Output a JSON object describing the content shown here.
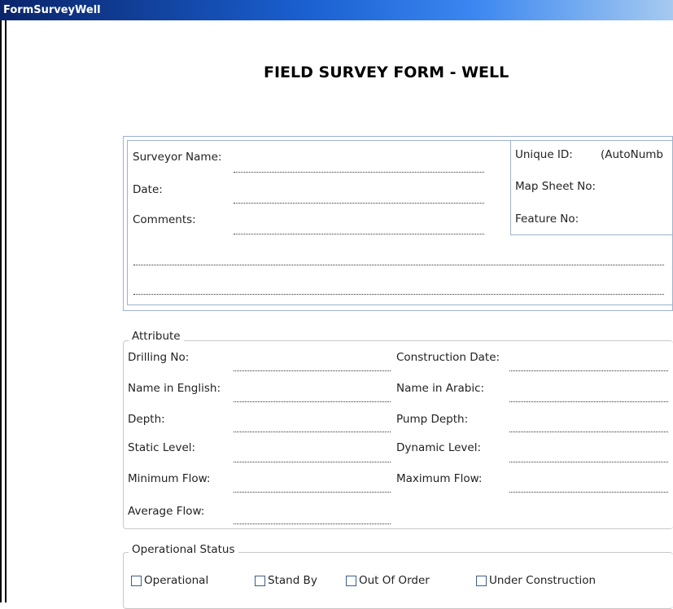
{
  "window": {
    "title": "FormSurveyWell"
  },
  "form": {
    "title": "FIELD SURVEY FORM - WELL"
  },
  "survey": {
    "surveyor_name_label": "Surveyor Name:",
    "date_label": "Date:",
    "comments_label": "Comments:",
    "unique_id_label": "Unique ID:",
    "unique_id_value": "(AutoNumb",
    "map_sheet_label": "Map Sheet No:",
    "feature_no_label": "Feature No:"
  },
  "attribute": {
    "legend": "Attribute",
    "drilling_no_label": "Drilling No:",
    "construction_date_label": "Construction Date:",
    "name_english_label": "Name in English:",
    "name_arabic_label": "Name in Arabic:",
    "depth_label": "Depth:",
    "pump_depth_label": "Pump Depth:",
    "static_level_label": "Static Level:",
    "dynamic_level_label": "Dynamic Level:",
    "minimum_flow_label": "Minimum Flow:",
    "maximum_flow_label": "Maximum Flow:",
    "average_flow_label": "Average Flow:"
  },
  "operational_status": {
    "legend": "Operational Status",
    "options": [
      {
        "label": "Operational",
        "checked": false
      },
      {
        "label": "Stand By",
        "checked": false
      },
      {
        "label": "Out Of Order",
        "checked": false
      },
      {
        "label": "Under Construction",
        "checked": false
      }
    ]
  }
}
